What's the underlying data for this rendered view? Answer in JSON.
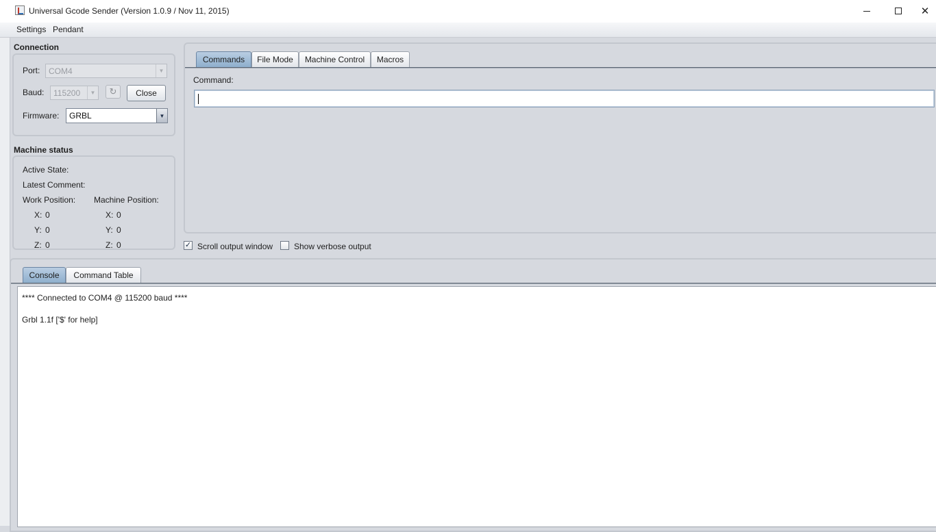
{
  "window": {
    "title": "Universal Gcode Sender (Version 1.0.9 / Nov 11, 2015)",
    "controls": {
      "minimize": "minimize",
      "maximize": "maximize",
      "close": "✕"
    }
  },
  "menu": [
    "Settings",
    "Pendant"
  ],
  "connection": {
    "heading": "Connection",
    "port_label": "Port:",
    "port_value": "COM4",
    "baud_label": "Baud:",
    "baud_value": "115200",
    "refresh_icon": "↻",
    "close_button": "Close",
    "firmware_label": "Firmware:",
    "firmware_value": "GRBL"
  },
  "machine_status": {
    "heading": "Machine status",
    "active_state_label": "Active State:",
    "latest_comment_label": "Latest Comment:",
    "work_position_label": "Work Position:",
    "machine_position_label": "Machine Position:",
    "work": {
      "x_label": "X:",
      "x": "0",
      "y_label": "Y:",
      "y": "0",
      "z_label": "Z:",
      "z": "0"
    },
    "machine": {
      "x_label": "X:",
      "x": "0",
      "y_label": "Y:",
      "y": "0",
      "z_label": "Z:",
      "z": "0"
    }
  },
  "top_tabs": [
    "Commands",
    "File Mode",
    "Machine Control",
    "Macros"
  ],
  "command": {
    "label": "Command:",
    "value": ""
  },
  "options": {
    "scroll_output": {
      "label": "Scroll output window",
      "checked": true,
      "mark": "✓"
    },
    "verbose_output": {
      "label": "Show verbose output",
      "checked": false
    }
  },
  "bottom_tabs": [
    "Console",
    "Command Table"
  ],
  "console": {
    "lines": [
      "**** Connected to COM4 @ 115200 baud ****",
      "",
      "Grbl 1.1f ['$' for help]"
    ]
  },
  "colors": {
    "background": "#d6d9df",
    "selected_tab": "#9fbbd6",
    "titlebar": "#ffffff"
  },
  "icons": {
    "app": "java-cup-icon",
    "refresh": "refresh-icon",
    "dropdown": "chevron-down-icon",
    "check": "checkmark-icon"
  }
}
